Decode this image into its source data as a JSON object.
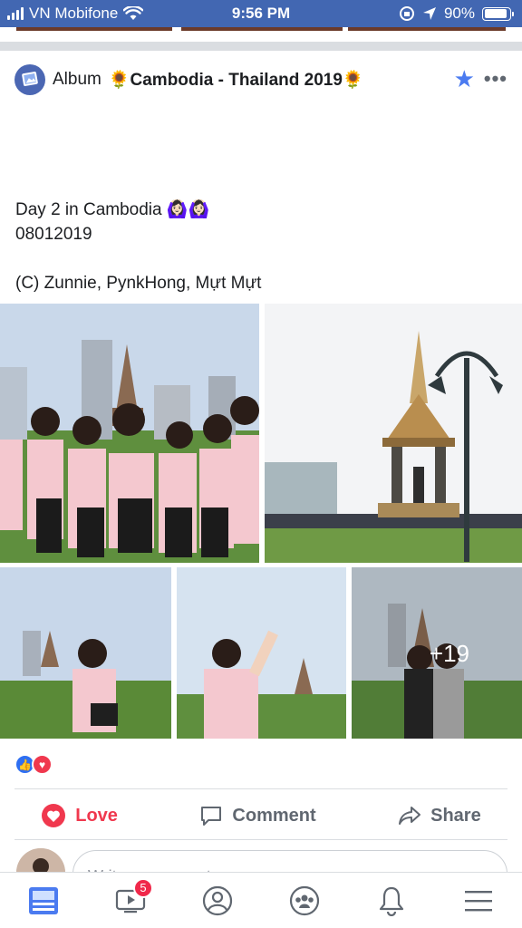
{
  "status_bar": {
    "carrier": "VN Mobifone",
    "time": "9:56 PM",
    "battery": "90%",
    "battery_level": 0.9
  },
  "post": {
    "album_label": "Album",
    "album_title": "🌻Cambodia - Thailand 2019🌻",
    "caption_lines": [
      "Day 2 in Cambodia 🙆🏻‍♀️🙆🏻‍♀️",
      "08012019",
      "",
      "(C) Zunnie, PynkHong, Mựt Mựt"
    ],
    "more_photos_count": "+19",
    "icons": {
      "album": "album-icon",
      "star": "star-icon",
      "more": "more-options-icon"
    }
  },
  "reactions": [
    "like",
    "love"
  ],
  "actions": {
    "love_label": "Love",
    "comment_label": "Comment",
    "share_label": "Share"
  },
  "comment": {
    "placeholder": "Write a comment..."
  },
  "tab_bar": {
    "items": [
      {
        "name": "news-feed",
        "icon": "news-feed-icon",
        "active": true
      },
      {
        "name": "watch",
        "icon": "video-icon",
        "badge": "5"
      },
      {
        "name": "profile",
        "icon": "profile-icon"
      },
      {
        "name": "groups",
        "icon": "groups-icon"
      },
      {
        "name": "notifications",
        "icon": "bell-icon"
      },
      {
        "name": "menu",
        "icon": "hamburger-menu-icon"
      }
    ]
  },
  "colors": {
    "status_bar": "#4267b2",
    "love": "#f0384e",
    "like": "#2e6ff2",
    "badge": "#f0284a"
  }
}
